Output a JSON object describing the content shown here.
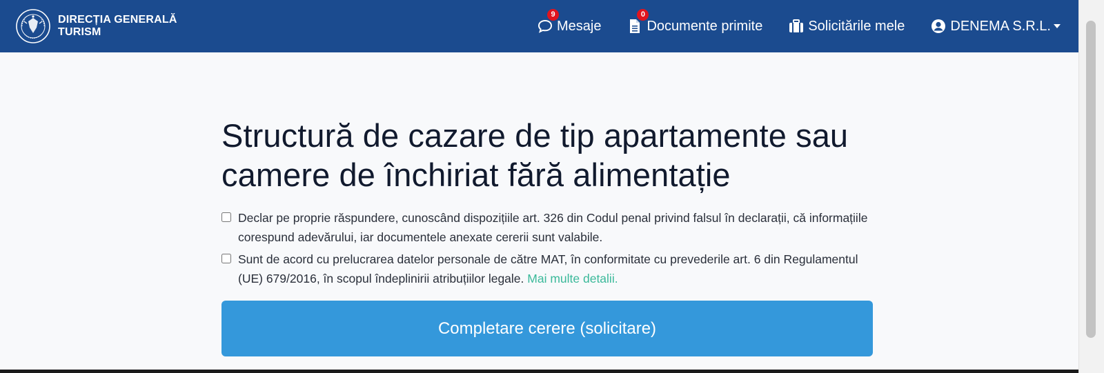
{
  "brand": {
    "name_line1": "DIRECȚIA GENERALĂ",
    "name_line2": "TURISM",
    "logo_icon": "guvernul-romaniei-seal-icon"
  },
  "nav": {
    "messages": {
      "label": "Mesaje",
      "badge": "9",
      "icon": "chat-bubble-icon"
    },
    "documents": {
      "label": "Documente primite",
      "badge": "0",
      "icon": "document-icon"
    },
    "requests": {
      "label": "Solicitările mele",
      "icon": "briefcase-icon"
    },
    "account": {
      "label": "DENEMA S.R.L.",
      "icon": "user-circle-icon"
    }
  },
  "main": {
    "title": "Structură de cazare de tip apartamente sau camere de închiriat fără alimentație",
    "declaration": {
      "text": "Declar pe proprie răspundere, cunoscând dispozițiile art. 326 din Codul penal privind falsul în declarații, că informațiile corespund adevărului, iar documentele anexate cererii sunt valabile.",
      "checked": false
    },
    "consent": {
      "text": "Sunt de acord cu prelucrarea datelor personale de către MAT, în conformitate cu prevederile art. 6 din Regulamentul (UE) 679/2016, în scopul îndeplinirii atribuțiilor legale.",
      "link_text": "Mai multe detalii.",
      "checked": false
    },
    "submit_label": "Completare cerere (solicitare)"
  },
  "colors": {
    "navbar": "#1b4b8f",
    "badge": "#e0141e",
    "button": "#3498db",
    "link": "#3bb99a",
    "background": "#f8f9fb"
  }
}
